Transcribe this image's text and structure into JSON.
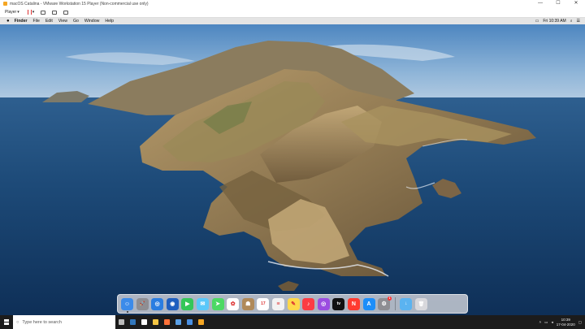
{
  "vm": {
    "window_title": "macOS Catalina - VMware Workstation 15 Player (Non-commercial use only)",
    "player_label": "Player",
    "window_controls": [
      "—",
      "☐",
      "✕"
    ]
  },
  "menubar": {
    "apple": "",
    "items": [
      "Finder",
      "File",
      "Edit",
      "View",
      "Go",
      "Window",
      "Help"
    ],
    "clock": "Fri 10:39 AM"
  },
  "dock": {
    "apps": [
      {
        "name": "Finder",
        "color": "#3b8bea",
        "glyph": "☺",
        "running": true
      },
      {
        "name": "Launchpad",
        "color": "#8e8e93",
        "glyph": "🚀"
      },
      {
        "name": "Safari",
        "color": "#2a7de1",
        "glyph": "◎"
      },
      {
        "name": "Photo Booth",
        "color": "#1f5fbf",
        "glyph": "◉"
      },
      {
        "name": "FaceTime",
        "color": "#34c759",
        "glyph": "▶"
      },
      {
        "name": "Messages",
        "color": "#5ac8fa",
        "glyph": "✉"
      },
      {
        "name": "Maps",
        "color": "#4cd964",
        "glyph": "➤"
      },
      {
        "name": "Photos",
        "color": "#ffffff",
        "glyph": "✿"
      },
      {
        "name": "Contacts",
        "color": "#b08a5a",
        "glyph": "☗"
      },
      {
        "name": "Calendar",
        "color": "#ffffff",
        "glyph": "17"
      },
      {
        "name": "Reminders",
        "color": "#f2f2f2",
        "glyph": "≡"
      },
      {
        "name": "Notes",
        "color": "#ffd84a",
        "glyph": "✎"
      },
      {
        "name": "Music",
        "color": "#fc3c44",
        "glyph": "♪"
      },
      {
        "name": "Podcasts",
        "color": "#9b4de0",
        "glyph": "◎"
      },
      {
        "name": "TV",
        "color": "#111111",
        "glyph": "tv"
      },
      {
        "name": "News",
        "color": "#ff3b30",
        "glyph": "N"
      },
      {
        "name": "App Store",
        "color": "#1c8ef9",
        "glyph": "A"
      },
      {
        "name": "System Preferences",
        "color": "#8e8e93",
        "glyph": "⚙",
        "badge": "1"
      }
    ],
    "right_items": [
      {
        "name": "Downloads",
        "color": "#5bb3f0",
        "glyph": "↓"
      },
      {
        "name": "Trash",
        "color": "#d8d8dc",
        "glyph": "🗑"
      }
    ]
  },
  "taskbar": {
    "search_placeholder": "Type here to search",
    "time": "10:39",
    "date": "17-04-2020",
    "apps": [
      {
        "name": "task-view",
        "color": "#bbbbbb"
      },
      {
        "name": "edge",
        "color": "#3277bc"
      },
      {
        "name": "store",
        "color": "#ffffff"
      },
      {
        "name": "file-explorer",
        "color": "#f4c542"
      },
      {
        "name": "firefox",
        "color": "#ff7139"
      },
      {
        "name": "mail",
        "color": "#5aa0e6"
      },
      {
        "name": "photos",
        "color": "#4a90e2"
      },
      {
        "name": "vmware",
        "color": "#f5a623"
      }
    ]
  }
}
